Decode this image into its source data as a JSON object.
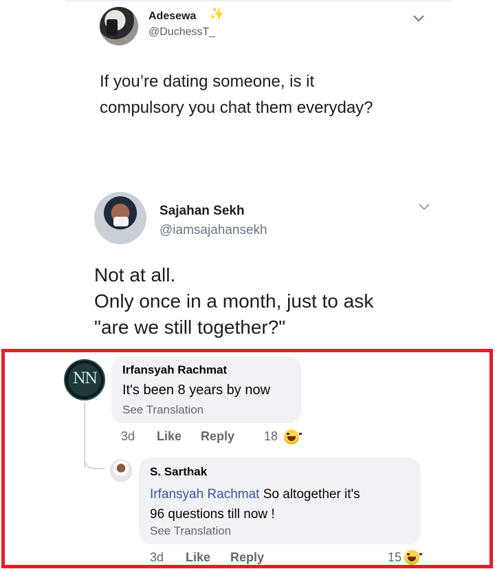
{
  "tweet1": {
    "name": "Adesewa",
    "badge": "✨",
    "handle": "@DuchessT_",
    "text_line1": "If you’re dating someone, is it",
    "text_line2": "compulsory you chat them everyday?"
  },
  "tweet2": {
    "name": "Sajahan Sekh",
    "handle": "@iamsajahansekh",
    "text_line1": "Not at all.",
    "text_line2": "Only once in a month, just to ask",
    "text_line3": "\"are we still together?\""
  },
  "comment1": {
    "name": "Irfansyah Rachmat",
    "text": "It's been 8 years by now",
    "see_translation": "See Translation",
    "time": "3d",
    "like_label": "Like",
    "reply_label": "Reply",
    "reaction_count": "18",
    "reaction_icon": "laughing-emoji"
  },
  "comment2": {
    "name": "S. Sarthak",
    "mention": "Irfansyah Rachmat",
    "text_after_mention": " So altogether it's",
    "text_line2": "96 questions till now !",
    "see_translation": "See Translation",
    "time": "3d",
    "like_label": "Like",
    "reply_label": "Reply",
    "reaction_count": "15",
    "reaction_icon": "laughing-emoji"
  },
  "colors": {
    "highlight_border": "#e41e26",
    "mention_link": "#385898",
    "bubble_bg": "#f0f2f5"
  }
}
